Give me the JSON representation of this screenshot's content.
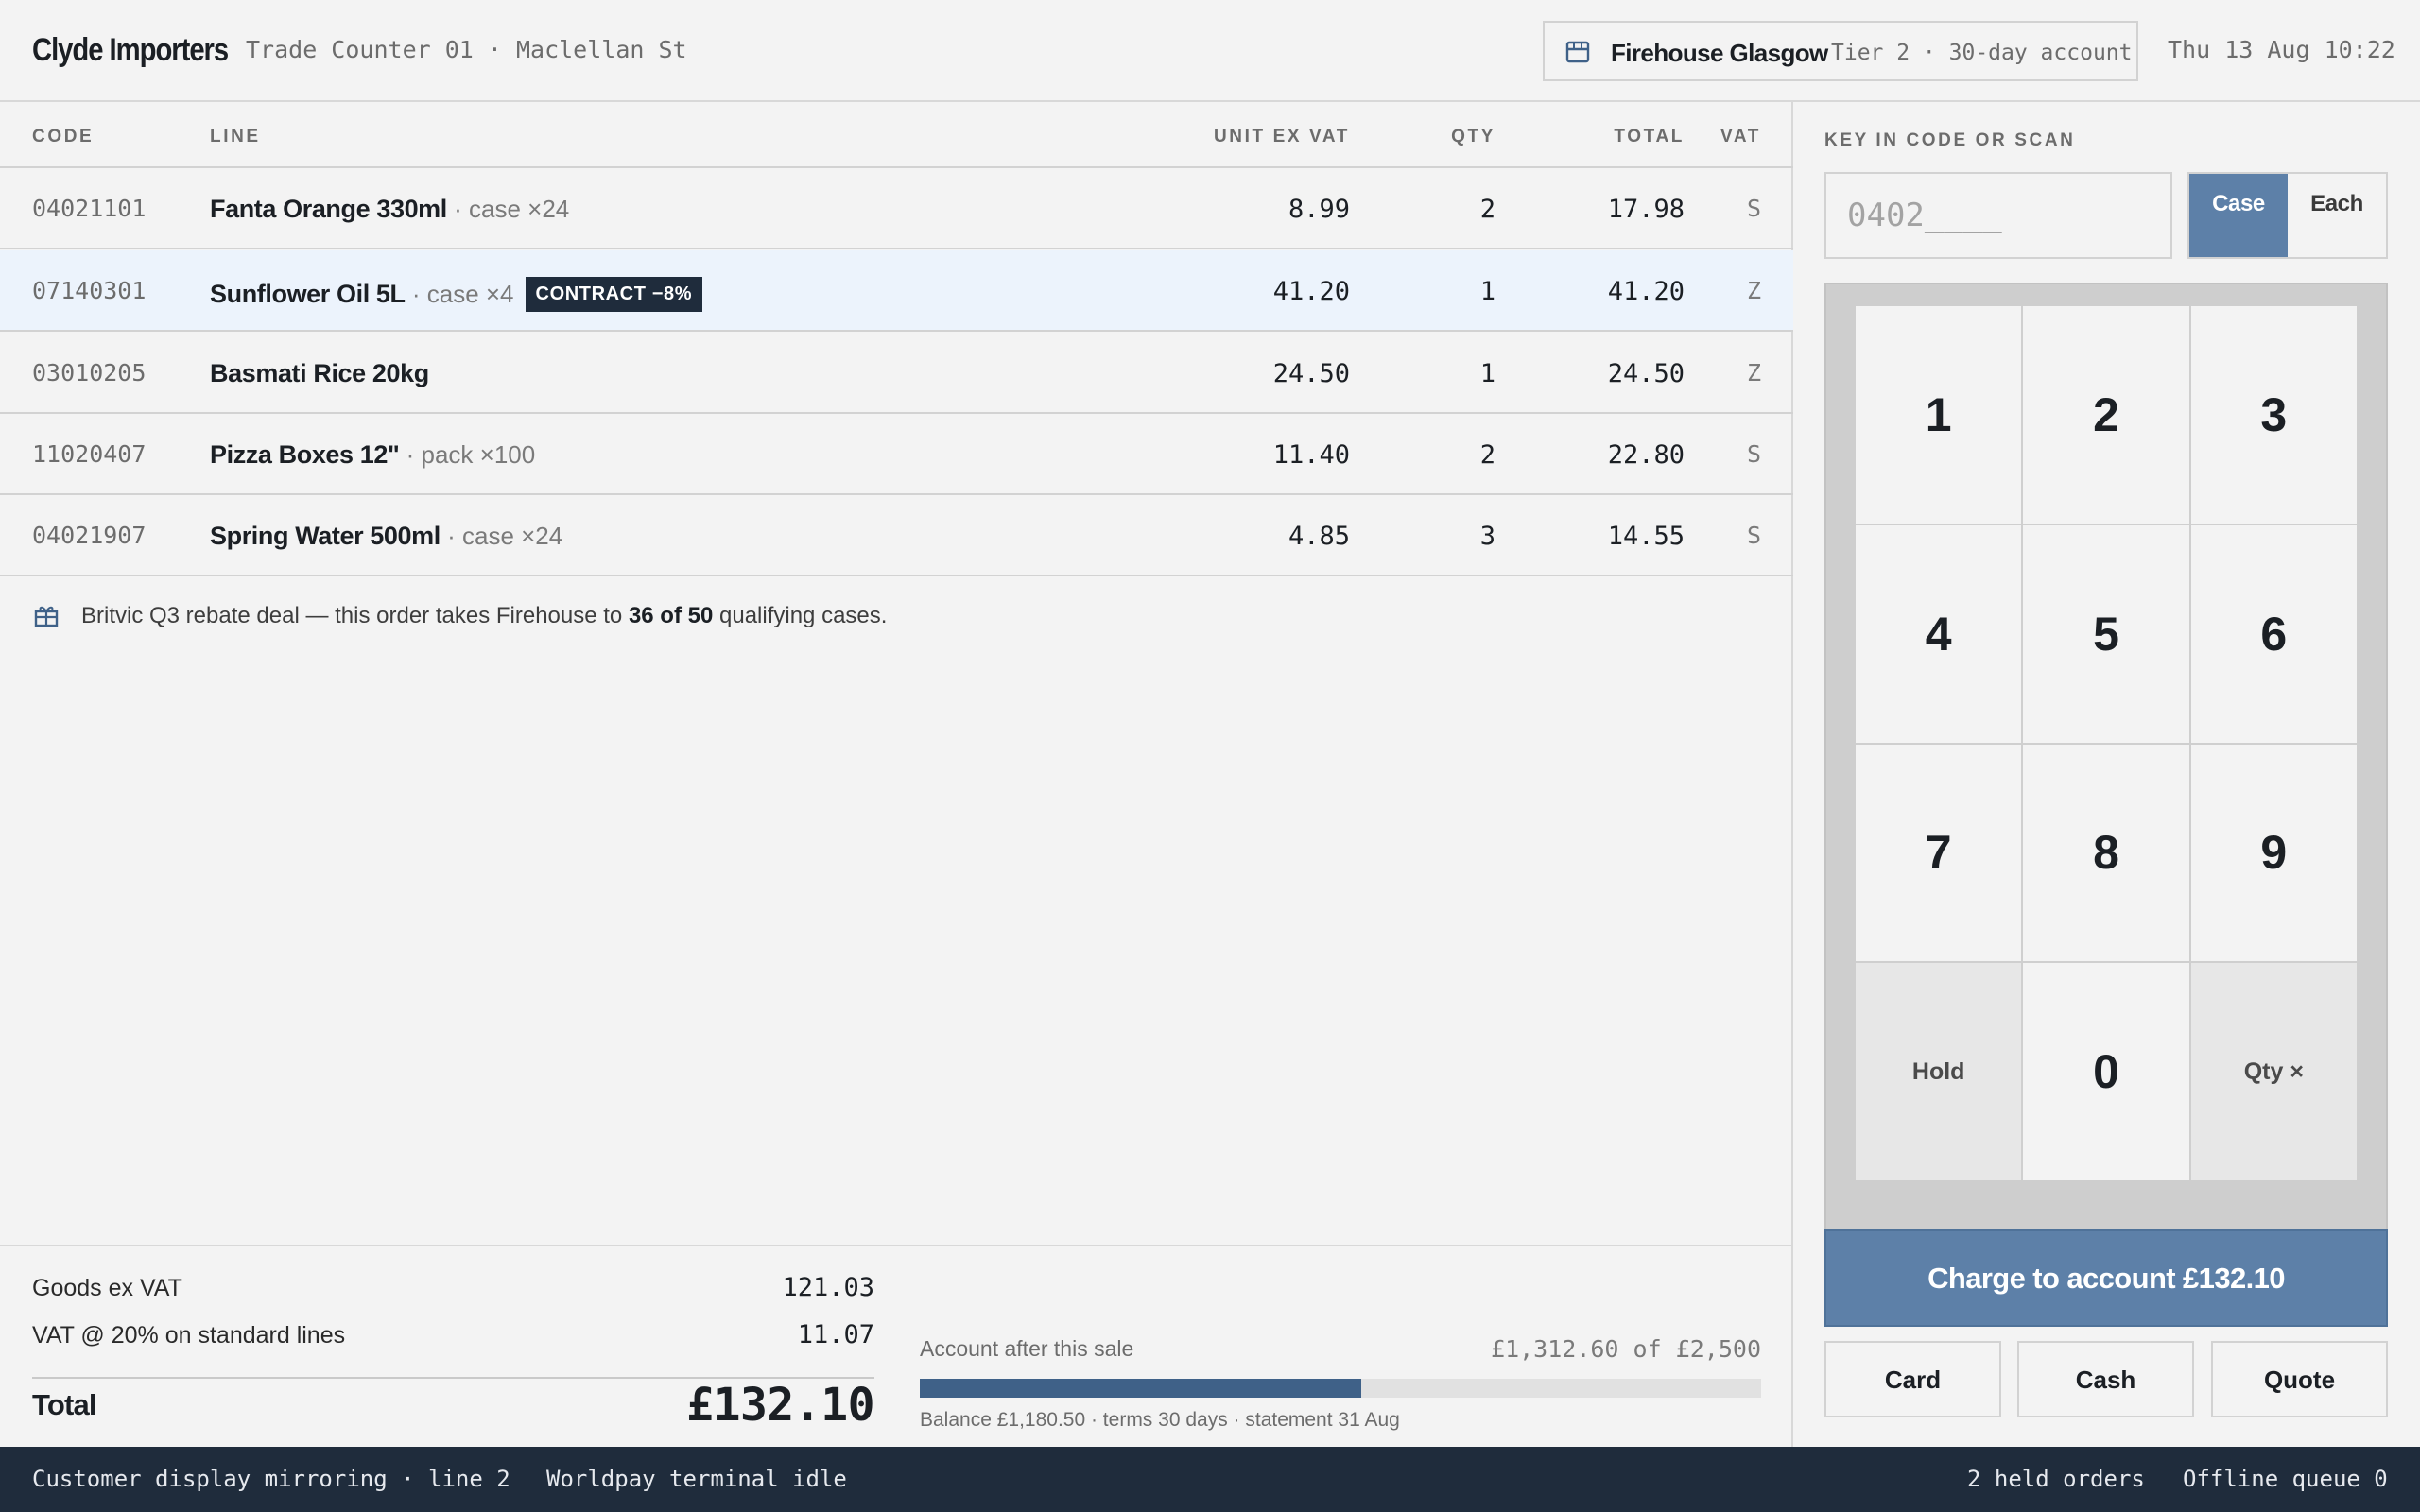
{
  "header": {
    "brand": "Clyde Importers",
    "location": "Trade Counter 01 · Maclellan St",
    "customer_name": "Firehouse Glasgow",
    "customer_terms": "Tier 2 · 30-day account",
    "clock": "Thu 13 Aug 10:22"
  },
  "table": {
    "headers": {
      "code": "CODE",
      "line": "LINE",
      "unit": "UNIT EX VAT",
      "qty": "QTY",
      "total": "TOTAL",
      "vat": "VAT"
    },
    "rows": [
      {
        "code": "04021101",
        "name": "Fanta Orange 330ml",
        "pack": " · case ×24",
        "badge": "",
        "unit": "8.99",
        "qty": "2",
        "total": "17.98",
        "vat": "S"
      },
      {
        "code": "07140301",
        "name": "Sunflower Oil 5L",
        "pack": " · case ×4",
        "badge": "CONTRACT −8%",
        "unit": "41.20",
        "qty": "1",
        "total": "41.20",
        "vat": "Z"
      },
      {
        "code": "03010205",
        "name": "Basmati Rice 20kg",
        "pack": "",
        "badge": "",
        "unit": "24.50",
        "qty": "1",
        "total": "24.50",
        "vat": "Z"
      },
      {
        "code": "11020407",
        "name": "Pizza Boxes 12\"",
        "pack": " · pack ×100",
        "badge": "",
        "unit": "11.40",
        "qty": "2",
        "total": "22.80",
        "vat": "S"
      },
      {
        "code": "04021907",
        "name": "Spring Water 500ml",
        "pack": " · case ×24",
        "badge": "",
        "unit": "4.85",
        "qty": "3",
        "total": "14.55",
        "vat": "S"
      }
    ],
    "selected_row": 1
  },
  "notice": {
    "before": "Britvic Q3 rebate deal — this order takes Firehouse to ",
    "bold": "36 of 50",
    "after": " qualifying cases."
  },
  "totals": {
    "goods_label": "Goods ex VAT",
    "goods_value": "121.03",
    "vat_label": "VAT @ 20% on standard lines",
    "vat_value": "11.07",
    "total_label": "Total",
    "total_value": "£132.10"
  },
  "account": {
    "label": "Account after this sale",
    "value": "£1,312.60 of £2,500",
    "fraction": 0.525,
    "sub": "Balance £1,180.50 · terms 30 days · statement 31 Aug"
  },
  "entry": {
    "label": "KEY IN CODE OR SCAN",
    "value": "0402____",
    "mode_case": "Case",
    "mode_each": "Each",
    "active_mode": "Case"
  },
  "keypad": {
    "keys": [
      "1",
      "2",
      "3",
      "4",
      "5",
      "6",
      "7",
      "8",
      "9",
      "Hold",
      "0",
      "Qty ×"
    ]
  },
  "actions": {
    "charge": "Charge to account £132.10",
    "card": "Card",
    "cash": "Cash",
    "quote": "Quote"
  },
  "status": {
    "display": "Customer display mirroring · line 2",
    "terminal": "Worldpay terminal idle",
    "held": "2 held orders",
    "offline": "Offline queue 0"
  },
  "colors": {
    "accent": "#5d80a8",
    "dark": "#1f2c3c",
    "selected_row": "#ecf3fc"
  }
}
